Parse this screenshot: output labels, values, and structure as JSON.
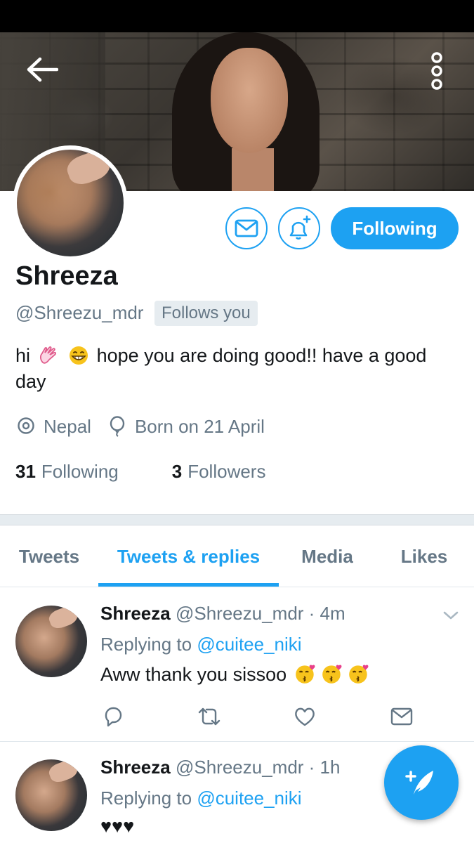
{
  "profile": {
    "display_name": "Shreeza",
    "handle": "@Shreezu_mdr",
    "follows_you": "Follows you",
    "bio_prefix": "hi",
    "bio_text": "hope you are doing good!! have a good day",
    "location": "Nepal",
    "birthday": "Born on 21 April",
    "following_count": "31",
    "following_label": "Following",
    "followers_count": "3",
    "followers_label": "Followers"
  },
  "actions": {
    "following_button": "Following"
  },
  "tabs": [
    {
      "label": "Tweets",
      "active": false
    },
    {
      "label": "Tweets & replies",
      "active": true
    },
    {
      "label": "Media",
      "active": false
    },
    {
      "label": "Likes",
      "active": false
    }
  ],
  "tweets": [
    {
      "name": "Shreeza",
      "handle_time": "@Shreezu_mdr · 4m",
      "replying_prefix": "Replying to",
      "replying_to": "@cuitee_niki",
      "text": "Aww thank you sissoo",
      "emoji": "kissing-face-with-heart x3"
    },
    {
      "name": "Shreeza",
      "handle_time": "@Shreezu_mdr · 1h",
      "replying_prefix": "Replying to",
      "replying_to": "@cuitee_niki",
      "text": "♥♥♥"
    }
  ],
  "colors": {
    "accent": "#1da1f2",
    "secondary_text": "#657786",
    "primary_text": "#14171a",
    "divider": "#e6ecf0"
  },
  "icons": [
    "back-arrow-icon",
    "more-vertical-icon",
    "mail-icon",
    "bell-plus-icon",
    "location-pin-icon",
    "balloon-icon",
    "reply-icon",
    "retweet-icon",
    "heart-icon",
    "chevron-down-icon",
    "compose-quill-icon"
  ]
}
